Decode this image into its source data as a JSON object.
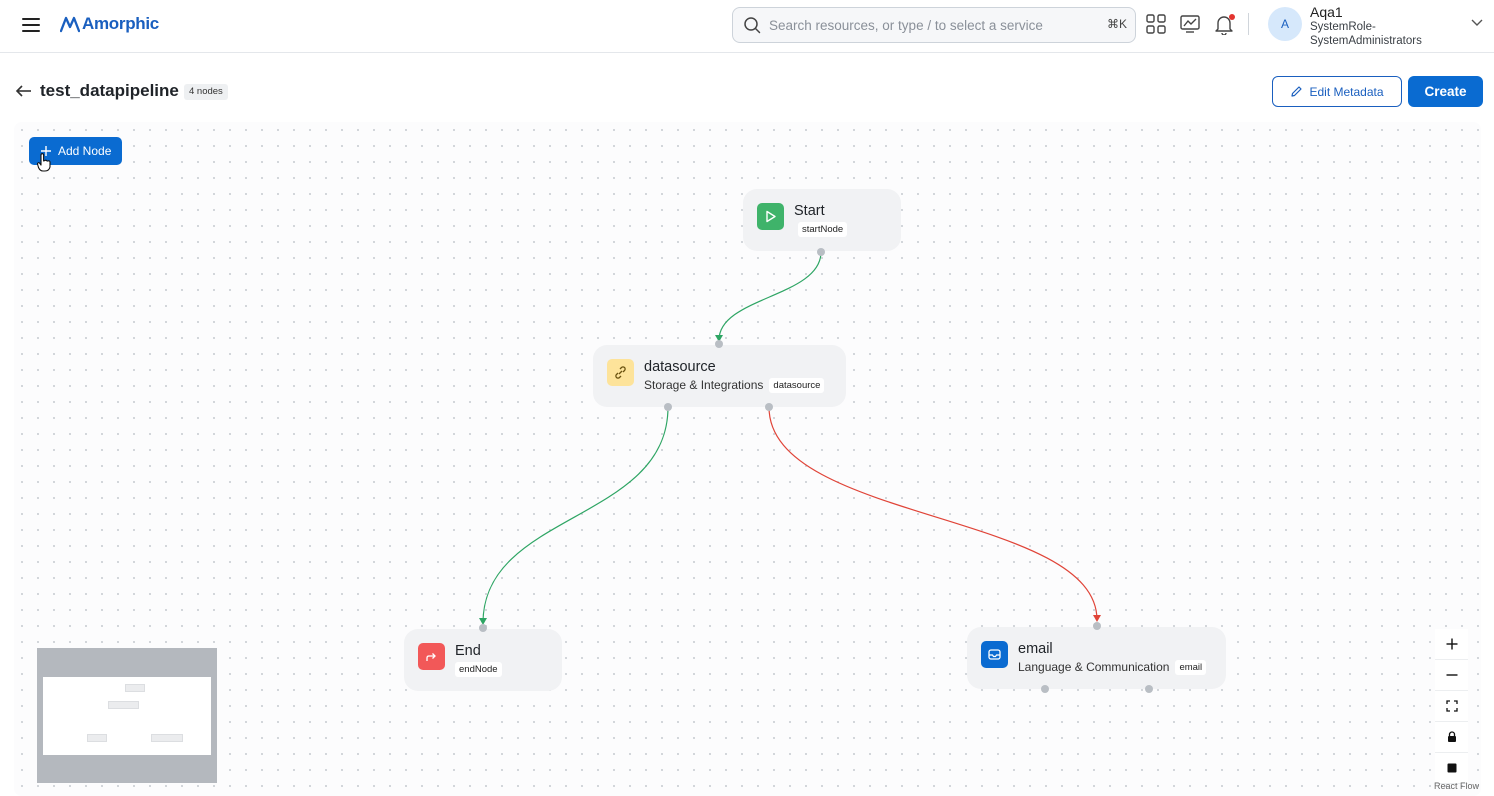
{
  "app": {
    "name": "Amorphic"
  },
  "search": {
    "placeholder": "Search resources, or type / to select a service",
    "shortcut": "⌘K"
  },
  "topbar_icons": [
    "apps-grid-icon",
    "monitor-chart-icon",
    "bell-icon"
  ],
  "user": {
    "initial": "A",
    "name": "Aqa1",
    "role": "SystemRole-SystemAdministrators"
  },
  "page": {
    "title": "test_datapipeline",
    "node_count": "4 nodes"
  },
  "actions": {
    "edit_metadata": "Edit Metadata",
    "create": "Create",
    "add_node": "Add Node"
  },
  "nodes": {
    "start": {
      "title": "Start",
      "tag": "startNode",
      "icon": "play-icon",
      "color": "#3fb36a"
    },
    "datasource": {
      "title": "datasource",
      "category": "Storage & Integrations",
      "tag": "datasource",
      "icon": "link-icon",
      "color": "#fde39a"
    },
    "end": {
      "title": "End",
      "tag": "endNode",
      "icon": "exit-icon",
      "color": "#f25858"
    },
    "email": {
      "title": "email",
      "category": "Language & Communication",
      "tag": "email",
      "icon": "inbox-icon",
      "color": "#0a6bd1"
    }
  },
  "edges": [
    {
      "from": "start",
      "to": "datasource",
      "status": "success",
      "color": "#2ea564"
    },
    {
      "from": "datasource",
      "to": "end",
      "status": "success",
      "color": "#2ea564"
    },
    {
      "from": "datasource",
      "to": "email",
      "status": "failure",
      "color": "#e04438"
    }
  ],
  "controls": [
    "zoom-in",
    "zoom-out",
    "fit-view",
    "lock",
    "stop"
  ],
  "attribution": "React Flow"
}
